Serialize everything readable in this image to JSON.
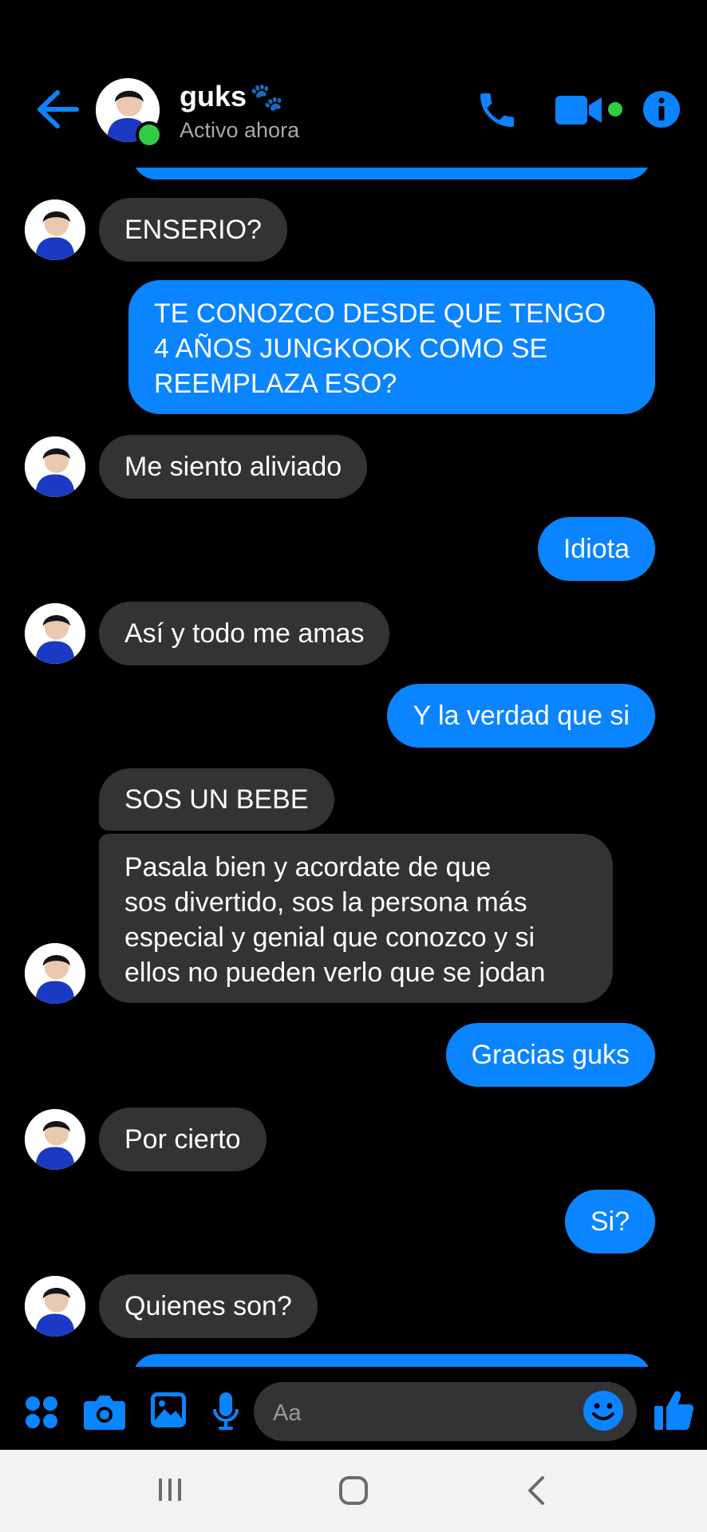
{
  "header": {
    "name": "guks",
    "emoji": "🐾",
    "status": "Activo ahora"
  },
  "messages": [
    {
      "from": "in",
      "text": "ENSERIO?"
    },
    {
      "from": "out",
      "lines": [
        "TE CONOZCO DESDE QUE TENGO",
        "4 AÑOS JUNGKOOK COMO SE",
        "REEMPLAZA ESO?"
      ]
    },
    {
      "from": "in",
      "text": "Me siento aliviado"
    },
    {
      "from": "out",
      "text": "Idiota"
    },
    {
      "from": "in",
      "text": "Así y todo me amas"
    },
    {
      "from": "out",
      "text": "Y la verdad que si"
    },
    {
      "from": "in",
      "text": "SOS UN BEBE"
    },
    {
      "from": "in",
      "lines": [
        "Pasala bien y acordate de que",
        "sos divertido, sos la persona más",
        "especial y genial que conozco y si",
        "ellos no pueden verlo que se jodan"
      ]
    },
    {
      "from": "out",
      "text": "Gracias guks"
    },
    {
      "from": "in",
      "text": "Por cierto"
    },
    {
      "from": "out",
      "text": "Si?"
    },
    {
      "from": "in",
      "text": "Quienes son?"
    }
  ],
  "composer": {
    "placeholder": "Aa"
  },
  "colors": {
    "accent": "#0a84ff",
    "incoming_bubble": "#333336",
    "online": "#31cc46"
  }
}
